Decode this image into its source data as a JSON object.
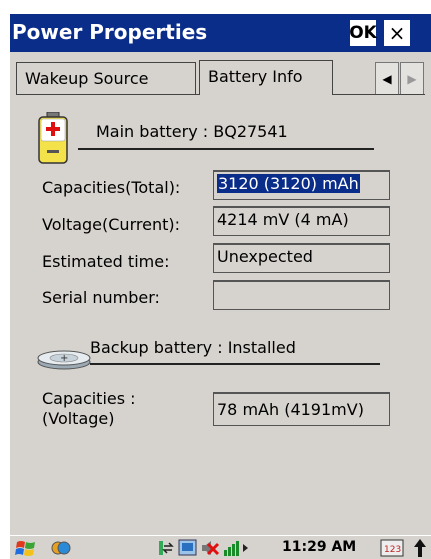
{
  "window": {
    "title": "Power Properties",
    "ok_label": "OK",
    "close_label": "×"
  },
  "tabs": [
    {
      "label": "Wakeup Source"
    },
    {
      "label": "Battery Info"
    }
  ],
  "tab_scroll": {
    "left": "◀",
    "right": "▶"
  },
  "main_battery": {
    "header": "Main battery :   BQ27541",
    "fields": {
      "capacities_label": "Capacities(Total):",
      "capacities_value": "3120 (3120) mAh",
      "voltage_label": "Voltage(Current):",
      "voltage_value": "4214 mV (4 mA)",
      "estimated_label": "Estimated time:",
      "estimated_value": "Unexpected",
      "serial_label": "Serial number:",
      "serial_value": ""
    }
  },
  "backup_battery": {
    "header": "Backup battery : Installed",
    "icon_text": "+",
    "capacities_label_line1": "Capacities :",
    "capacities_label_line2": "(Voltage)",
    "capacities_value": "78 mAh (4191mV)"
  },
  "taskbar": {
    "clock": "11:29 AM",
    "input_icon_text": "123"
  },
  "colors": {
    "title_bar": "#0a2d8a",
    "client_bg": "#d6d3ce",
    "selection": "#0a2d8a"
  }
}
